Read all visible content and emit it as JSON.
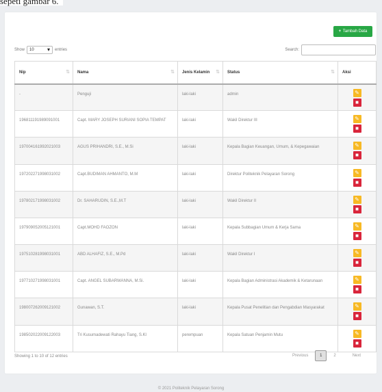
{
  "caption": "sepeti gambar 6.",
  "toolbar": {
    "add_label": "Tambah Data",
    "add_icon": "plus-icon"
  },
  "length": {
    "prefix": "Show",
    "value": "10",
    "suffix": "entries"
  },
  "search": {
    "label": "Search:",
    "value": ""
  },
  "table": {
    "columns": [
      "Nip",
      "Nama",
      "Jenis Kelamin",
      "Status",
      "Aksi"
    ],
    "rows": [
      {
        "nip": "-",
        "nama": "Penguji",
        "jk": "laki-laki",
        "status": "admin"
      },
      {
        "nip": "196811191989091001",
        "nama": "Capt. MARY JOSEPH SURIANI SOPIA TEMPAT",
        "jk": "laki-laki",
        "status": "Wakil Direktur III"
      },
      {
        "nip": "197004161992021003",
        "nama": "AGUS PRIHANDRI, S.E., M.Si",
        "jk": "laki-laki",
        "status": "Kepala Bagian Keuangan, Umum, & Kepegawaian"
      },
      {
        "nip": "197202271998031002",
        "nama": "Capt.BUDIMAN AHMANTO, M.M",
        "jk": "laki-laki",
        "status": "Direktur Politeknik Pelayaran Sorong"
      },
      {
        "nip": "197802171998031002",
        "nama": "Dr. SAHARUDIN, S.E.,M.T",
        "jk": "laki-laki",
        "status": "Wakil Direktur II"
      },
      {
        "nip": "197909052005121001",
        "nama": "Capt.MOHD FAOZON",
        "jk": "laki-laki",
        "status": "Kepala Subbagian Umum & Kerja Sama"
      },
      {
        "nip": "197510281998031001",
        "nama": "ABD ALHAFIZ, S.E., M.Pd",
        "jk": "laki-laki",
        "status": "Wakil Direktur I"
      },
      {
        "nip": "197710271998031001",
        "nama": "Capt. ANGEL SUBARWANNA, M.Si.",
        "jk": "laki-laki",
        "status": "Kepala Bagian Administrasi Akademik & Ketarunaan"
      },
      {
        "nip": "198007262009121002",
        "nama": "Gunawan, S.T.",
        "jk": "laki-laki",
        "status": "Kepala Pusat Penelitian dan Pengabdian Masyarakat"
      },
      {
        "nip": "198502022009122003",
        "nama": "Tri Kusumadewati Rahayu Tiang, S.Kl",
        "jk": "perempuan",
        "status": "Kepala Satuan Penjamin Mutu"
      }
    ]
  },
  "actions": {
    "edit_icon": "pencil-icon",
    "delete_icon": "trash-icon",
    "edit_color": "#f7b924",
    "delete_color": "#d9253b"
  },
  "info": "Showing 1 to 10 of 12 entries",
  "pagination": {
    "previous": "Previous",
    "current": "1",
    "next_page": "2",
    "next": "Next"
  },
  "footer": "© 2021 Politeknik Pelayaran Sorong",
  "colors": {
    "add_button": "#28a745",
    "background": "#eceef1"
  }
}
